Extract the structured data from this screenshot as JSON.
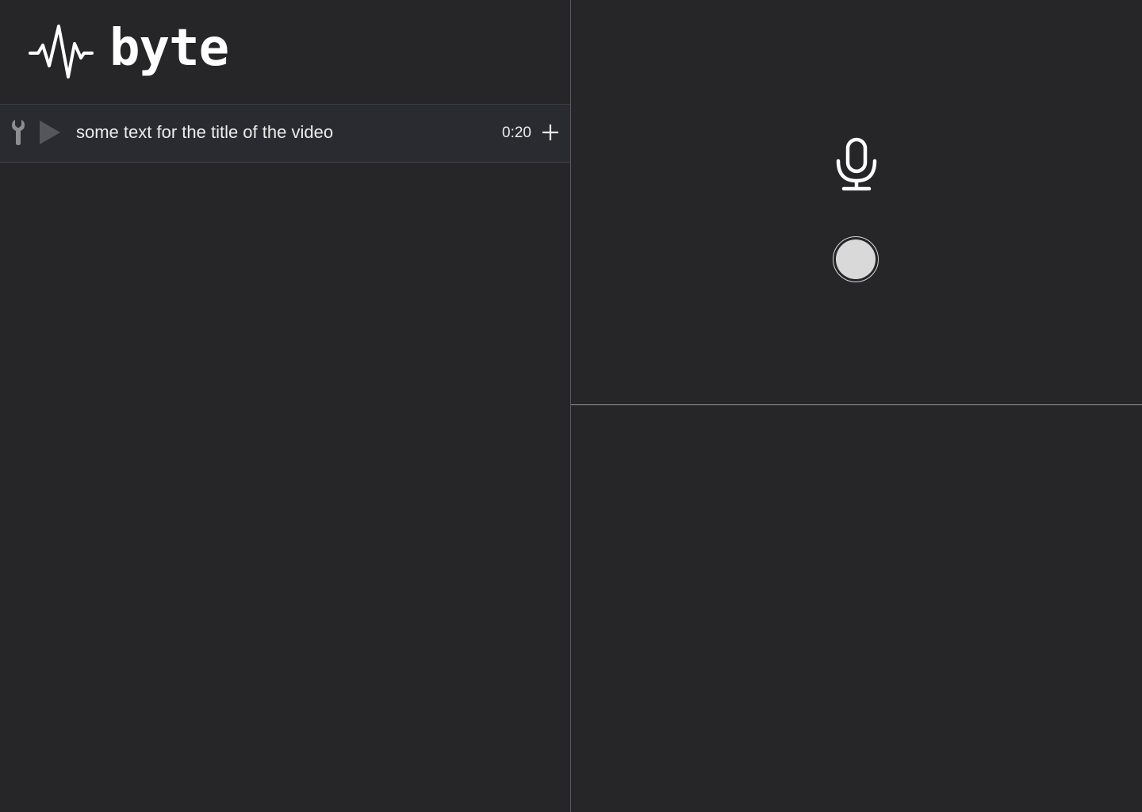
{
  "app": {
    "name": "byte",
    "logo_icon": "waveform-icon"
  },
  "colors": {
    "background": "#262628",
    "row_background": "#2a2b30",
    "text": "#ececec",
    "icon_muted": "#8e8e92",
    "record_button": "#d9d9d9"
  },
  "video_list": {
    "items": [
      {
        "title": "some text for the title of the video",
        "duration": "0:20",
        "icons": [
          "wrench-icon",
          "play-icon",
          "plus-icon"
        ]
      }
    ]
  },
  "recorder": {
    "icons": [
      "microphone-icon",
      "record-button"
    ]
  }
}
